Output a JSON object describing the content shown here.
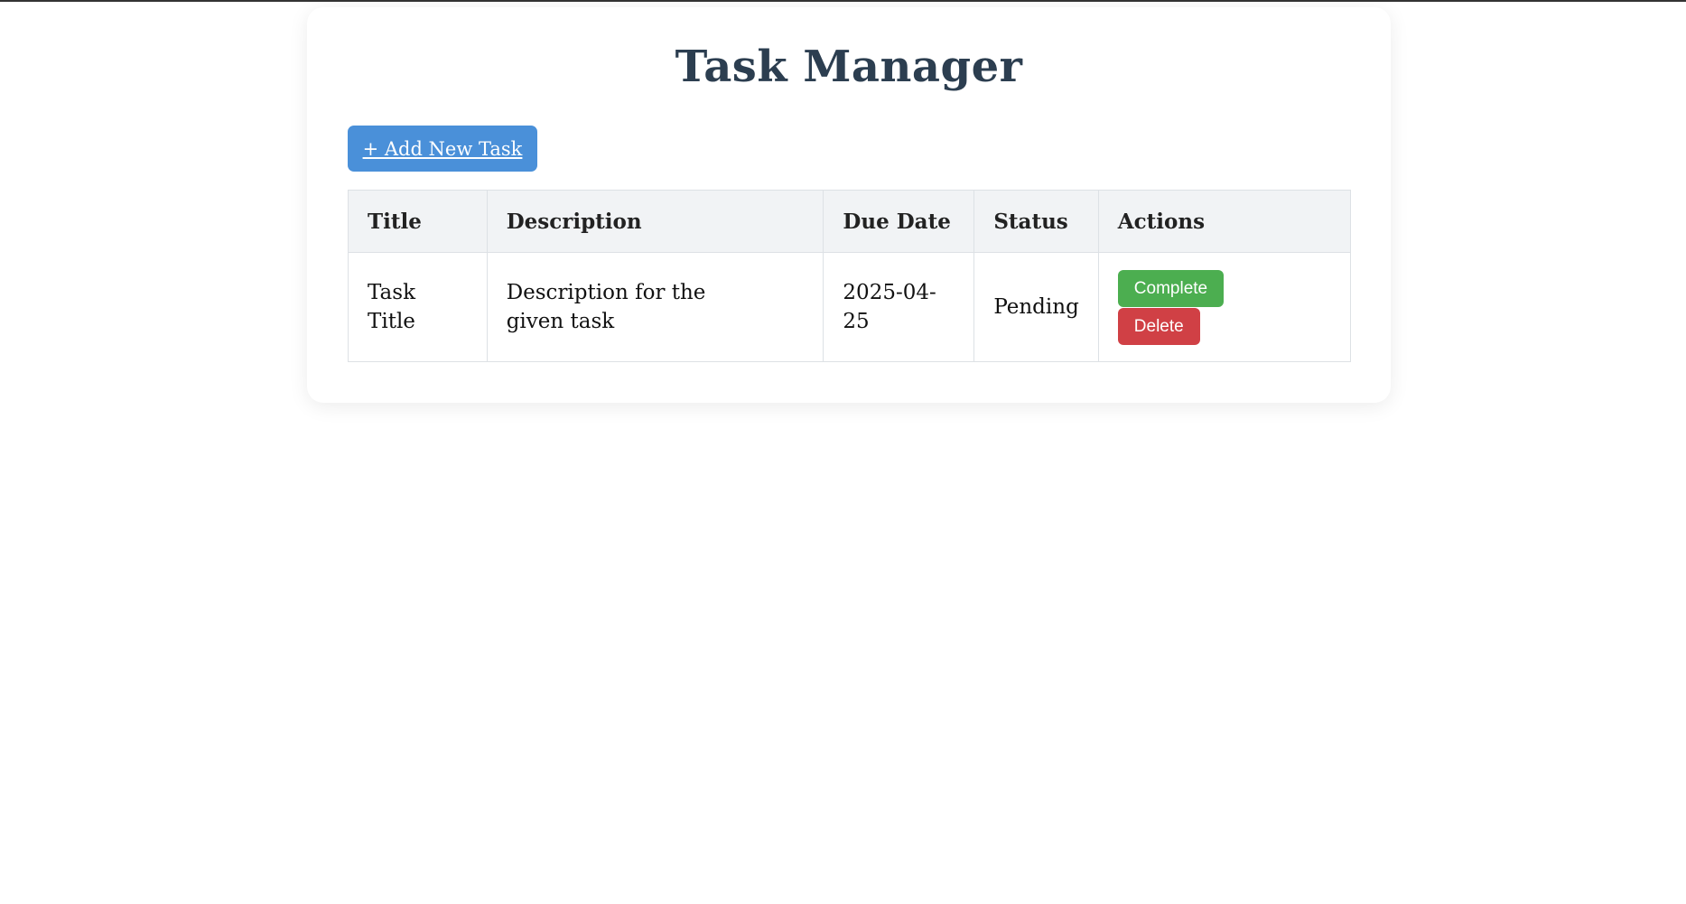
{
  "page": {
    "title": "Task Manager"
  },
  "toolbar": {
    "add_task_label": "+ Add New Task"
  },
  "table": {
    "headers": [
      "Title",
      "Description",
      "Due Date",
      "Status",
      "Actions"
    ],
    "rows": [
      {
        "title": "Task Title",
        "description": "Description for the given task",
        "due_date": "2025-04-25",
        "status": "Pending",
        "actions": {
          "complete_label": "Complete",
          "delete_label": "Delete"
        }
      }
    ]
  },
  "colors": {
    "title": "#2c3e50",
    "add_button": "#4a90d9",
    "complete_button": "#4cae50",
    "delete_button": "#d04045",
    "header_bg": "#f1f3f5"
  }
}
